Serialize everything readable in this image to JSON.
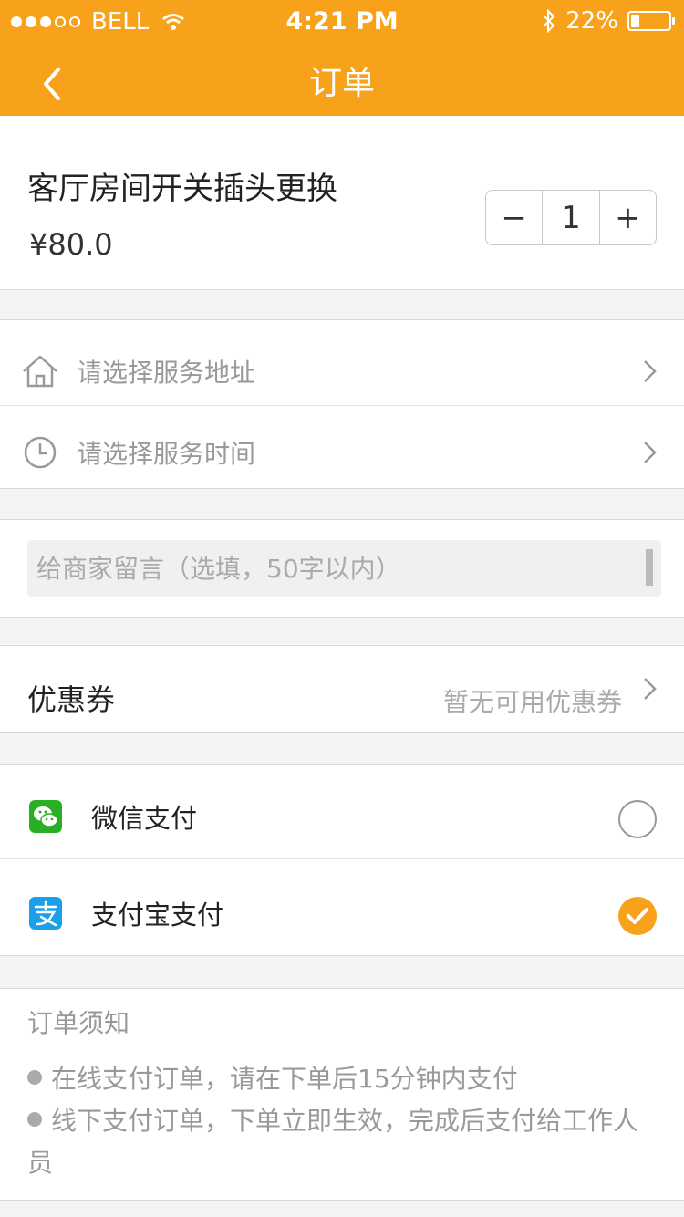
{
  "status_bar": {
    "carrier": "BELL",
    "time": "4:21 PM",
    "battery": "22%",
    "battery_level": 0.22
  },
  "nav": {
    "title": "订单",
    "back_icon": "chevron-left-icon"
  },
  "product": {
    "name": "客厅房间开关插头更换",
    "price": "¥80.0",
    "quantity": "1",
    "minus": "−",
    "plus": "+"
  },
  "service": {
    "address_placeholder": "请选择服务地址",
    "time_placeholder": "请选择服务时间"
  },
  "message": {
    "placeholder": "给商家留言（选填，50字以内）"
  },
  "coupon": {
    "label": "优惠券",
    "value": "暂无可用优惠券"
  },
  "payment": {
    "options": [
      {
        "label": "微信支付",
        "icon": "wechat-icon",
        "selected": false,
        "color": "#2aae24"
      },
      {
        "label": "支付宝支付",
        "icon": "alipay-icon",
        "selected": true,
        "color": "#1aa0e8"
      }
    ],
    "selected_color": "#f7a21a"
  },
  "notice": {
    "title": "订单须知",
    "items": [
      "在线支付订单，请在下单后15分钟内支付",
      "线下支付订单，下单立即生效，完成后支付给工作人员"
    ]
  },
  "colors": {
    "accent": "#f7a21a"
  }
}
